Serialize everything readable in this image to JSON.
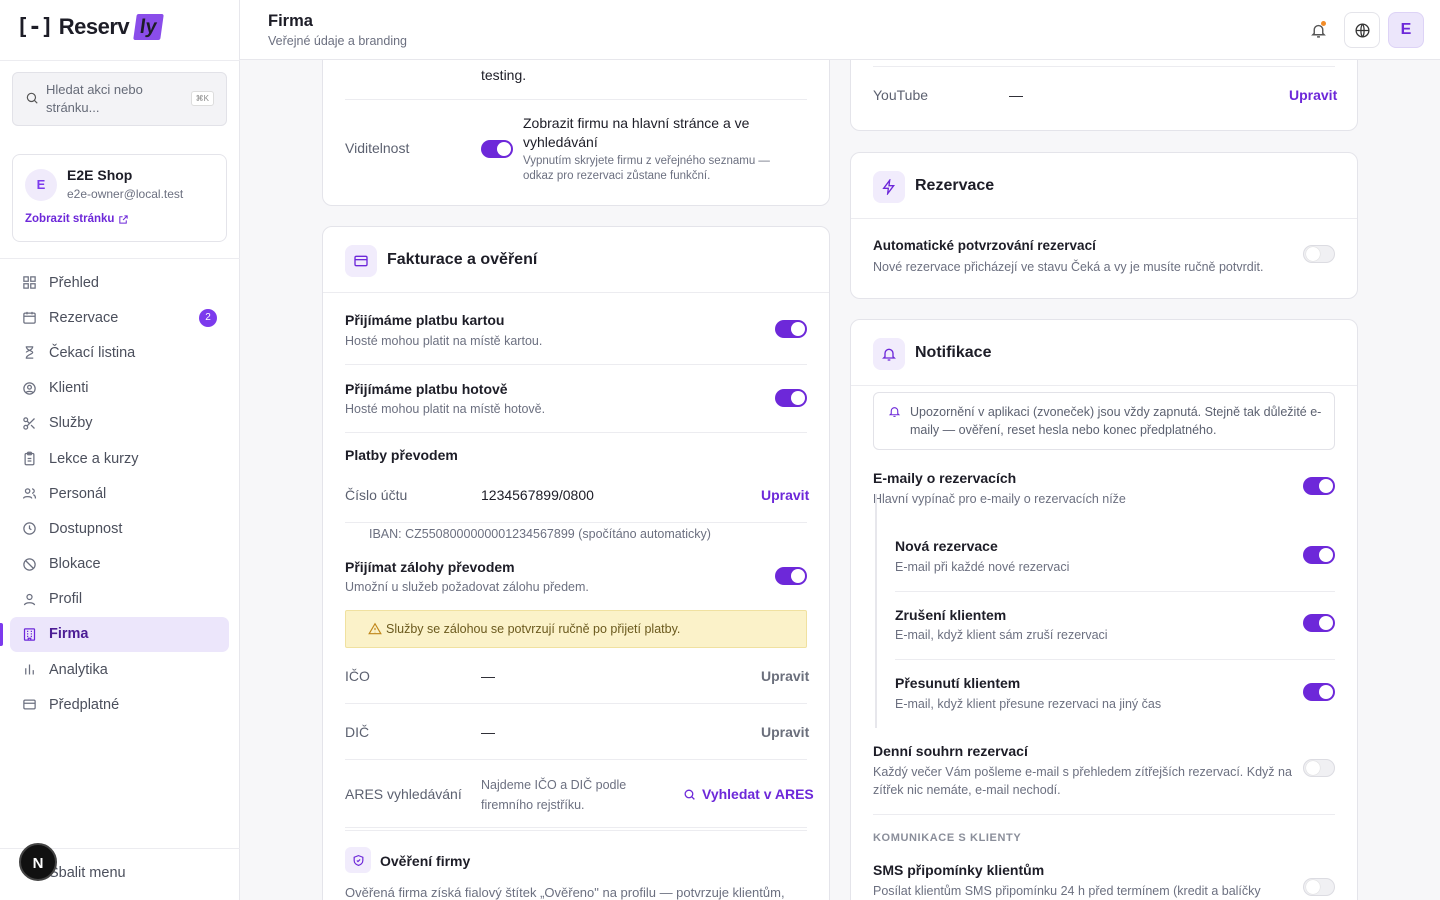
{
  "brand": {
    "logo_left": "[-]",
    "logo_main": "Reserv",
    "logo_accent": "ly"
  },
  "search": {
    "placeholder": "Hledat akci nebo stránku...",
    "shortcut": "⌘K"
  },
  "shop": {
    "avatar": "E",
    "name": "E2E Shop",
    "email": "e2e-owner@local.test",
    "link": "Zobrazit stránku"
  },
  "nav": [
    {
      "label": "Přehled",
      "icon": "grid-icon"
    },
    {
      "label": "Rezervace",
      "icon": "calendar-icon",
      "badge": "2"
    },
    {
      "label": "Čekací listina",
      "icon": "hourglass-icon"
    },
    {
      "label": "Klienti",
      "icon": "user-circle-icon"
    },
    {
      "label": "Služby",
      "icon": "scissors-icon"
    },
    {
      "label": "Lekce a kurzy",
      "icon": "clipboard-icon"
    },
    {
      "label": "Personál",
      "icon": "users-icon"
    },
    {
      "label": "Dostupnost",
      "icon": "clock-icon"
    },
    {
      "label": "Blokace",
      "icon": "ban-icon"
    },
    {
      "label": "Profil",
      "icon": "user-icon"
    },
    {
      "label": "Firma",
      "icon": "building-icon",
      "active": true
    },
    {
      "label": "Analytika",
      "icon": "bar-chart-icon"
    },
    {
      "label": "Předplatné",
      "icon": "credit-card-icon"
    }
  ],
  "collapse_label": "Sbalit menu",
  "fab_letter": "N",
  "header": {
    "title": "Firma",
    "subtitle": "Veřejné údaje a branding",
    "user_initial": "E"
  },
  "top_card": {
    "partial_text": "testing.",
    "visibility_label": "Viditelnost",
    "visibility_title": "Zobrazit firmu na hlavní stránce a ve vyhledávání",
    "visibility_desc": "Vypnutím skryjete firmu z veřejného seznamu — odkaz pro rezervaci zůstane funkční.",
    "visibility_on": true
  },
  "billing": {
    "title": "Fakturace a ověření",
    "card_title": "Přijímáme platbu kartou",
    "card_desc": "Hosté mohou platit na místě kartou.",
    "card_on": true,
    "cash_title": "Přijímáme platbu hotově",
    "cash_desc": "Hosté mohou platit na místě hotově.",
    "cash_on": true,
    "transfer_heading": "Platby převodem",
    "account_label": "Číslo účtu",
    "account_value": "1234567899/0800",
    "edit": "Upravit",
    "iban": "IBAN: CZ5508000000001234567899 (spočítáno automaticky)",
    "deposit_title": "Přijímat zálohy převodem",
    "deposit_desc": "Umožní u služeb požadovat zálohu předem.",
    "deposit_on": true,
    "warning": "Služby se zálohou se potvrzují ručně po přijetí platby.",
    "ico_label": "IČO",
    "ico_value": "—",
    "dic_label": "DIČ",
    "dic_value": "—",
    "ares_label": "ARES vyhledávání",
    "ares_desc": "Najdeme IČO a DIČ podle firemního rejstříku.",
    "ares_button": "Vyhledat v ARES",
    "verify_title": "Ověření firmy",
    "verify_desc": "Ověřená firma získá fialový štítek „Ověřeno\" na profilu — potvrzuje klientům,"
  },
  "social": {
    "youtube_label": "YouTube",
    "youtube_value": "—",
    "edit": "Upravit"
  },
  "reservations": {
    "title": "Rezervace",
    "auto_title": "Automatické potvrzování rezervací",
    "auto_desc": "Nové rezervace přicházejí ve stavu Čeká a vy je musíte ručně potvrdit.",
    "auto_on": false
  },
  "notifications": {
    "title": "Notifikace",
    "info": "Upozornění v aplikaci (zvoneček) jsou vždy zapnutá. Stejně tak důležité e-maily — ověření, reset hesla nebo konec předplatného.",
    "emails_title": "E-maily o rezervacích",
    "emails_desc": "Hlavní vypínač pro e-maily o rezervacích níže",
    "emails_on": true,
    "new_title": "Nová rezervace",
    "new_desc": "E-mail při každé nové rezervaci",
    "new_on": true,
    "cancel_title": "Zrušení klientem",
    "cancel_desc": "E-mail, když klient sám zruší rezervaci",
    "cancel_on": true,
    "move_title": "Přesunutí klientem",
    "move_desc": "E-mail, když klient přesune rezervaci na jiný čas",
    "move_on": true,
    "daily_title": "Denní souhrn rezervací",
    "daily_desc": "Každý večer Vám pošleme e-mail s přehledem zítřejších rezervací. Když na zítřek nic nemáte, e-mail nechodí.",
    "daily_on": false,
    "comm_caption": "KOMUNIKACE S KLIENTY",
    "sms_title": "SMS připomínky klientům",
    "sms_desc": "Posílat klientům SMS připomínku 24 h před termínem (kredit a balíčky",
    "sms_on": false
  },
  "colors": {
    "accent": "#6d28d9",
    "accent_light": "#ece6fb",
    "warning_bg": "#fbf2c9"
  }
}
